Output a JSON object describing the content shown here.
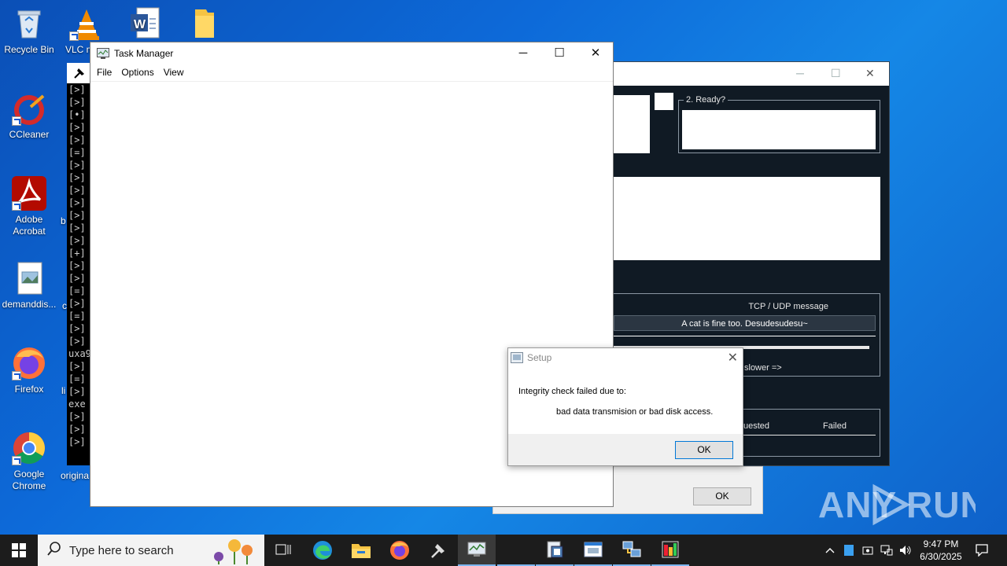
{
  "desktop": {
    "icons": [
      {
        "label": "Recycle Bin"
      },
      {
        "label": "VLC m"
      },
      {
        "label": "CCleaner"
      },
      {
        "label": "Adobe Acrobat"
      },
      {
        "label": "demanddis..."
      },
      {
        "label": "Firefox"
      },
      {
        "label": "Google Chrome"
      }
    ],
    "peek_labels": [
      "b",
      "c",
      "li",
      "origina"
    ]
  },
  "terminal": {
    "lines": [
      "[>]",
      "[>]",
      "[•]",
      "[>]",
      "[>]",
      "[=]",
      "[>]",
      "[>]",
      "[>]",
      "[>]",
      "[>]",
      "[>]",
      "[>]",
      "[+]",
      "[>]",
      "[>]",
      "[=]",
      "[>]",
      "[=]",
      "[>]",
      "[>]",
      "uxa9",
      "[>]",
      "[=]",
      "[>]",
      "exe",
      "[>]",
      "[>]",
      "[>]"
    ]
  },
  "task_manager": {
    "title": "Task Manager",
    "menu": [
      "File",
      "Options",
      "View"
    ],
    "controls": {
      "minimize": "─",
      "maximize": "☐",
      "close": "✕"
    }
  },
  "dark_app": {
    "ready_label": "2. Ready?",
    "tcp_label": "TCP / UDP message",
    "tcp_value": "A cat is fine too. Desudesudesu~",
    "slower_label": "slower =>",
    "col_requested": "uested",
    "col_failed": "Failed"
  },
  "under_dialog": {
    "ok_label": "OK"
  },
  "setup_dialog": {
    "title": "Setup",
    "message_line1": "Integrity check failed due to:",
    "message_line2": "bad data transmision or bad disk access.",
    "ok_label": "OK"
  },
  "watermark": "ANY RUN",
  "taskbar": {
    "search_placeholder": "Type here to search",
    "time": "9:47 PM",
    "date": "6/30/2025"
  }
}
